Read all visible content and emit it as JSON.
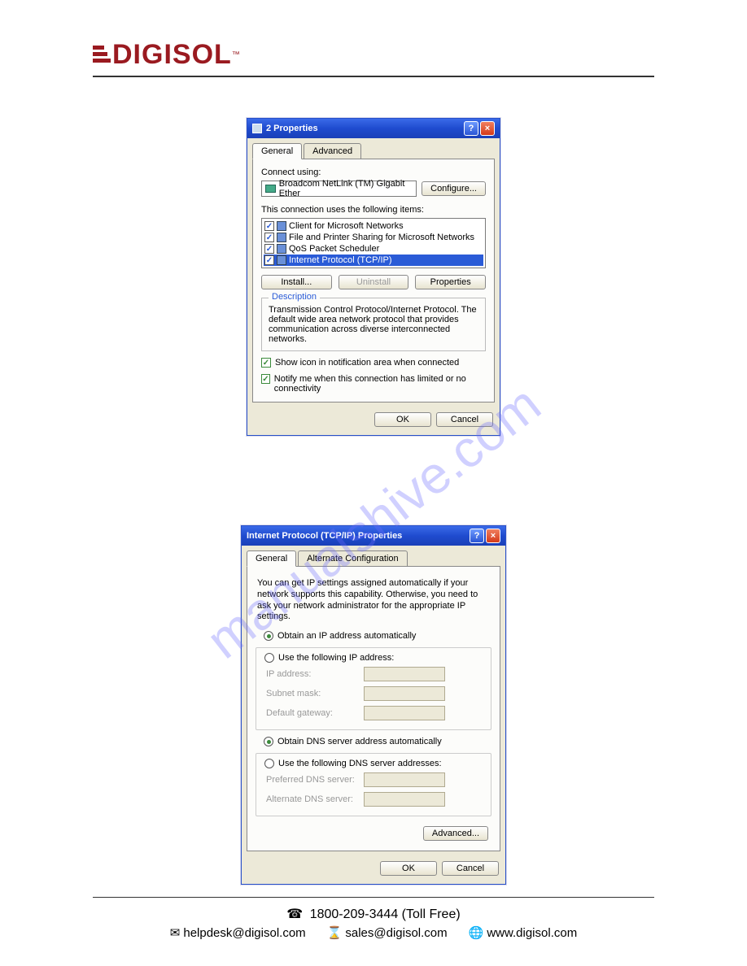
{
  "logo_text": "DIGISOL",
  "logo_tm": "™",
  "watermark": "manualshive.com",
  "dialog1": {
    "title": "2 Properties",
    "tabs": [
      "General",
      "Advanced"
    ],
    "connect_label": "Connect using:",
    "adapter": "Broadcom NetLink (TM) Gigabit Ether",
    "configure_btn": "Configure...",
    "items_label": "This connection uses the following items:",
    "items": [
      "Client for Microsoft Networks",
      "File and Printer Sharing for Microsoft Networks",
      "QoS Packet Scheduler",
      "Internet Protocol (TCP/IP)"
    ],
    "install_btn": "Install...",
    "uninstall_btn": "Uninstall",
    "properties_btn": "Properties",
    "desc_legend": "Description",
    "desc_text": "Transmission Control Protocol/Internet Protocol. The default wide area network protocol that provides communication across diverse interconnected networks.",
    "check1": "Show icon in notification area when connected",
    "check2": "Notify me when this connection has limited or no connectivity",
    "ok": "OK",
    "cancel": "Cancel"
  },
  "dialog2": {
    "title": "Internet Protocol (TCP/IP) Properties",
    "tabs": [
      "General",
      "Alternate Configuration"
    ],
    "intro": "You can get IP settings assigned automatically if your network supports this capability. Otherwise, you need to ask your network administrator for the appropriate IP settings.",
    "r1": "Obtain an IP address automatically",
    "r2": "Use the following IP address:",
    "ip_label": "IP address:",
    "mask_label": "Subnet mask:",
    "gw_label": "Default gateway:",
    "r3": "Obtain DNS server address automatically",
    "r4": "Use the following DNS server addresses:",
    "pdns": "Preferred DNS server:",
    "adns": "Alternate DNS server:",
    "advanced": "Advanced...",
    "ok": "OK",
    "cancel": "Cancel"
  },
  "footer": {
    "phone": "1800-209-3444 (Toll Free)",
    "email1": "helpdesk@digisol.com",
    "email2": "sales@digisol.com",
    "web": "www.digisol.com"
  }
}
